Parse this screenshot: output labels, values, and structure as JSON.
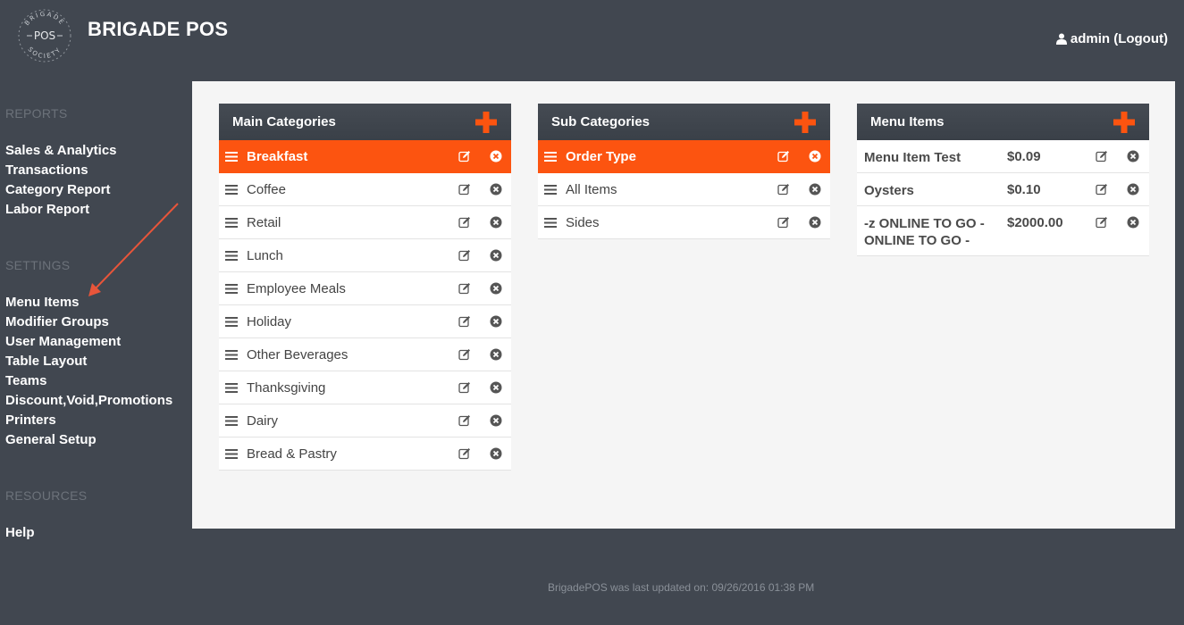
{
  "header": {
    "brand": "BRIGADE POS",
    "logo_text_top": "BRIGADE",
    "logo_text_mid": "POS",
    "logo_text_bottom": "SOCIETY",
    "user_label": "admin (Logout)"
  },
  "sidebar": {
    "reports_heading": "REPORTS",
    "reports": [
      "Sales & Analytics",
      "Transactions",
      "Category Report",
      "Labor Report"
    ],
    "settings_heading": "SETTINGS",
    "settings": [
      "Menu Items",
      "Modifier Groups",
      "User Management",
      "Table Layout",
      "Teams",
      "Discount,Void,Promotions",
      "Printers",
      "General Setup"
    ],
    "resources_heading": "RESOURCES",
    "resources": [
      "Help"
    ]
  },
  "main_categories": {
    "title": "Main Categories",
    "items": [
      "Breakfast",
      "Coffee",
      "Retail",
      "Lunch",
      "Employee Meals",
      "Holiday",
      "Other Beverages",
      "Thanksgiving",
      "Dairy",
      "Bread & Pastry"
    ],
    "active_index": 0
  },
  "sub_categories": {
    "title": "Sub Categories",
    "items": [
      "Order Type",
      "All Items",
      "Sides"
    ],
    "active_index": 0
  },
  "menu_items": {
    "title": "Menu Items",
    "items": [
      {
        "name": "Menu Item Test",
        "price": "$0.09"
      },
      {
        "name": "Oysters",
        "price": "$0.10"
      },
      {
        "name": "-z ONLINE TO GO - ONLINE TO GO -",
        "price": "$2000.00"
      }
    ]
  },
  "footer": {
    "text": "BrigadePOS was last updated on: 09/26/2016 01:38 PM"
  },
  "colors": {
    "accent": "#fc5410",
    "background": "#414750",
    "panel": "#f5f5f5"
  },
  "icons": {
    "plus": "plus-icon",
    "edit": "edit-icon",
    "delete": "close-circle-icon",
    "drag": "drag-handle-icon",
    "user": "user-icon"
  }
}
